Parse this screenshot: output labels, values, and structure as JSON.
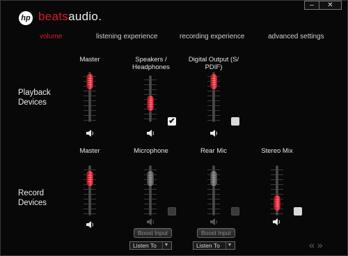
{
  "brand": {
    "mark": "hp",
    "beats": "beats",
    "audio": "audio."
  },
  "window": {
    "minimize_label": "–",
    "close_label": "✕"
  },
  "tabs": [
    {
      "label": "volume",
      "active": true
    },
    {
      "label": "listening experience",
      "active": false
    },
    {
      "label": "recording experience",
      "active": false
    },
    {
      "label": "advanced settings",
      "active": false
    }
  ],
  "playback": {
    "section_line1": "Playback",
    "section_line2": "Devices",
    "channels": [
      {
        "label_line1": "Master",
        "label_line2": "",
        "level": 0.95,
        "checkbox": null
      },
      {
        "label_line1": "Speakers /",
        "label_line2": "Headphones",
        "level": 0.35,
        "checkbox": "checked"
      },
      {
        "label_line1": "Digital Output (S/",
        "label_line2": "PDIF)",
        "level": 0.95,
        "checkbox": "unchecked"
      }
    ],
    "check_glyph": "✔"
  },
  "record": {
    "section_line1": "Record",
    "section_line2": "Devices",
    "channels": [
      {
        "label": "Master",
        "level": 0.85,
        "checkbox": null
      },
      {
        "label": "Microphone",
        "level": 0.85,
        "checkbox": "unchecked",
        "disabled": true,
        "boost_label": "Boost Input",
        "listen_label": "Listen To"
      },
      {
        "label": "Rear Mic",
        "level": 0.85,
        "checkbox": "unchecked",
        "disabled": true,
        "boost_label": "Boost Input",
        "listen_label": "Listen To"
      },
      {
        "label": "Stereo Mix",
        "level": 0.15,
        "checkbox": "unchecked",
        "disabled": false
      }
    ]
  },
  "nav": {
    "arrows": "«»"
  },
  "colors": {
    "accent": "#d41c2c",
    "background": "#080808"
  }
}
